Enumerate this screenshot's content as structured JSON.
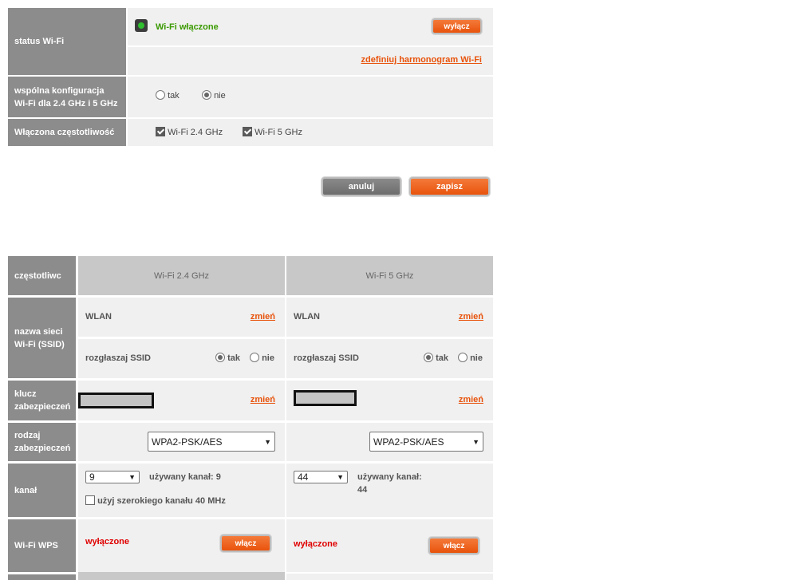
{
  "status": {
    "label": "status Wi-Fi",
    "state_text": "Wi-Fi włączone",
    "off_button": "wyłącz",
    "schedule_link": "zdefiniuj harmonogram Wi-Fi"
  },
  "common_config": {
    "label": "wspólna konfiguracja Wi-Fi dla 2.4 GHz i 5 GHz",
    "yes": "tak",
    "no": "nie",
    "selected": "nie"
  },
  "freq_enabled": {
    "label": "Włączona częstotliwość",
    "opt1": "Wi-Fi 2.4 GHz",
    "opt2": "Wi-Fi 5 GHz"
  },
  "actions": {
    "cancel": "anuluj",
    "save": "zapisz"
  },
  "bands": {
    "header_label": "częstotliwc",
    "ssid_label": "nazwa sieci Wi-Fi (SSID)",
    "key_label": "klucz zabezpieczeń",
    "security_label": "rodzaj zabezpieczeń",
    "channel_label": "kanał",
    "wps_label": "Wi-Fi WPS",
    "change": "zmień",
    "broadcast": "rozgłaszaj SSID",
    "yes": "tak",
    "no": "nie",
    "wide_channel": "użyj szerokiego kanału 40 MHz",
    "b24": {
      "name": "Wi-Fi 2.4 GHz",
      "ssid": "WLAN",
      "security": "WPA2-PSK/AES",
      "channel": "9",
      "used_channel": "używany kanał: 9",
      "wps_state": "wyłączone",
      "wps_button": "włącz"
    },
    "b5": {
      "name": "Wi-Fi 5 GHz",
      "ssid": "WLAN",
      "security": "WPA2-PSK/AES",
      "channel": "44",
      "used_channel_1": "używany kanał:",
      "used_channel_2": "44",
      "wps_state": "wyłączone",
      "wps_button": "włącz"
    }
  },
  "colors": {
    "accent": "#e8530c",
    "label_bg": "#8c8c8c",
    "cell_bg": "#f0f0f0",
    "status_on": "#3a9a00"
  }
}
